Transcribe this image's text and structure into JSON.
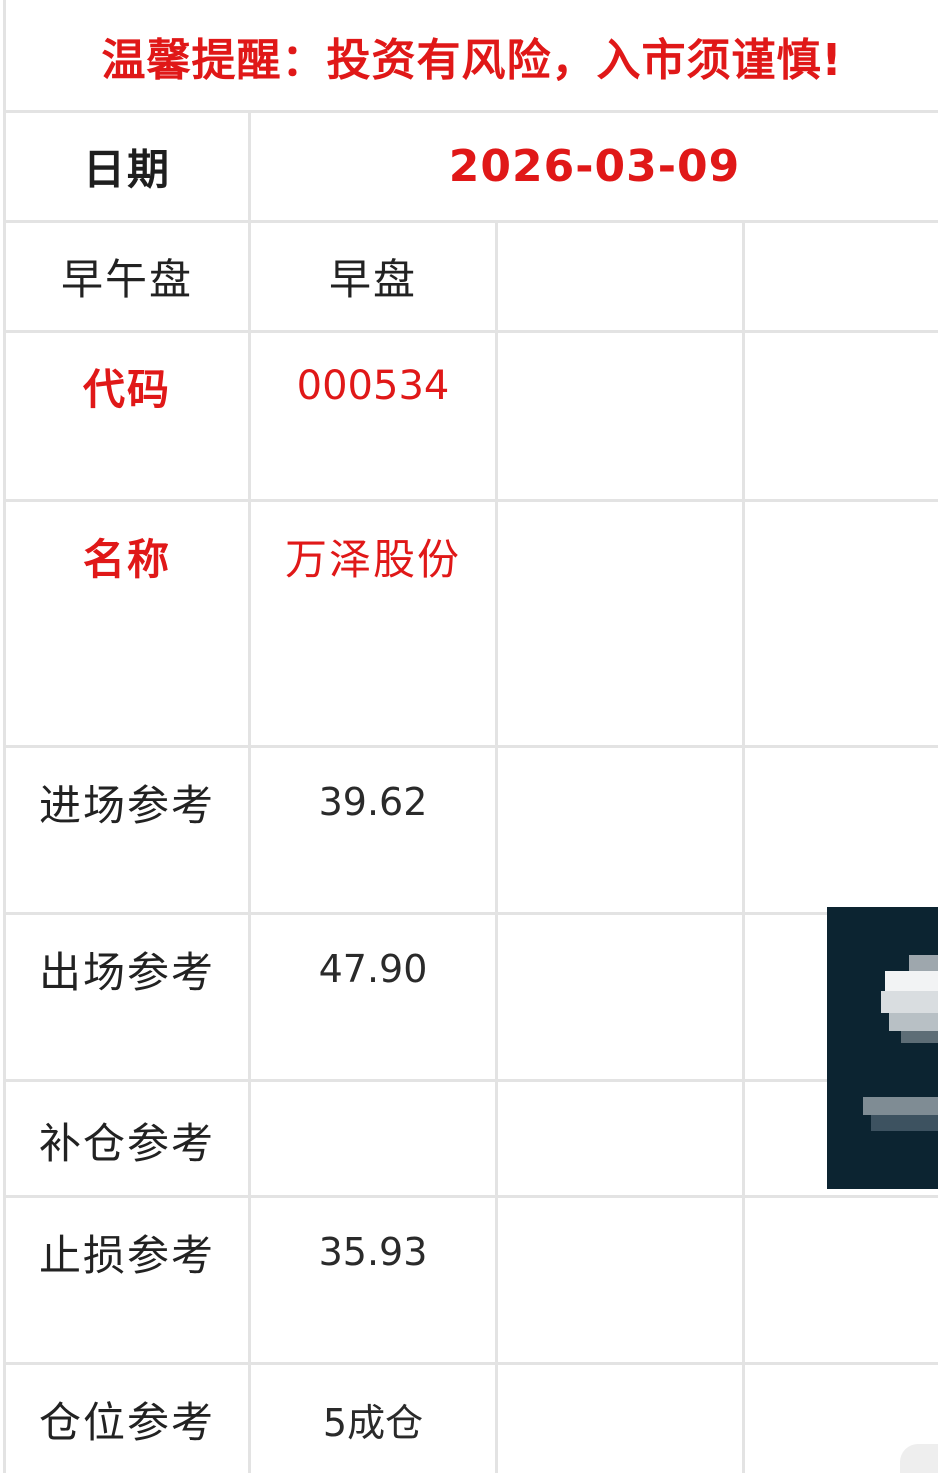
{
  "banner": "温馨提醒：投资有风险，入市须谨慎!",
  "date_row": {
    "label": "日期",
    "value": "2026-03-09"
  },
  "session_row": {
    "label": "早午盘",
    "value": "早盘"
  },
  "code_row": {
    "label": "代码",
    "value": "000534"
  },
  "name_row": {
    "label": "名称",
    "value": "万泽股份"
  },
  "entry_row": {
    "label": "进场参考",
    "value": "39.62"
  },
  "exit_row": {
    "label": "出场参考",
    "value": "47.90"
  },
  "add_row": {
    "label": "补仓参考",
    "value": ""
  },
  "stop_row": {
    "label": "止损参考",
    "value": "35.93"
  },
  "position_row": {
    "label": "仓位参考",
    "value": "5成仓"
  },
  "colors": {
    "accent_red": "#e01818",
    "grid_line": "#e3e3e3",
    "text": "#222222",
    "overlay": "#0c2431"
  }
}
